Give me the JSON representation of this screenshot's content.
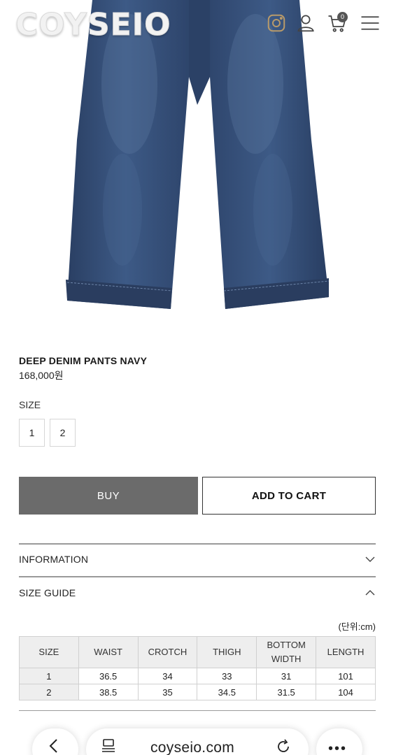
{
  "header": {
    "logo_text": "COYSEIO",
    "cart_count": "0"
  },
  "product": {
    "name": "DEEP DENIM PANTS NAVY",
    "price": "168,000원",
    "size_label": "SIZE",
    "size_options": [
      "1",
      "2"
    ],
    "buy_label": "BUY",
    "add_to_cart_label": "ADD TO CART"
  },
  "accordion": {
    "information_label": "INFORMATION",
    "size_guide_label": "SIZE GUIDE"
  },
  "size_guide": {
    "unit_note": "(단위:cm)",
    "headers": [
      "SIZE",
      "WAIST",
      "CROTCH",
      "THIGH",
      "BOTTOM WIDTH",
      "LENGTH"
    ],
    "rows": [
      [
        "1",
        "36.5",
        "34",
        "33",
        "31",
        "101"
      ],
      [
        "2",
        "38.5",
        "35",
        "34.5",
        "31.5",
        "104"
      ]
    ]
  },
  "browser": {
    "url": "coyseio.com"
  },
  "icons": {
    "header": [
      "instagram-icon",
      "user-icon",
      "cart-icon",
      "menu-icon"
    ],
    "browser": [
      "back-icon",
      "tabs-icon",
      "reload-icon",
      "more-icon"
    ]
  },
  "colors": {
    "buy_button": "#6b6b6b",
    "denim": "#2f4a72"
  }
}
